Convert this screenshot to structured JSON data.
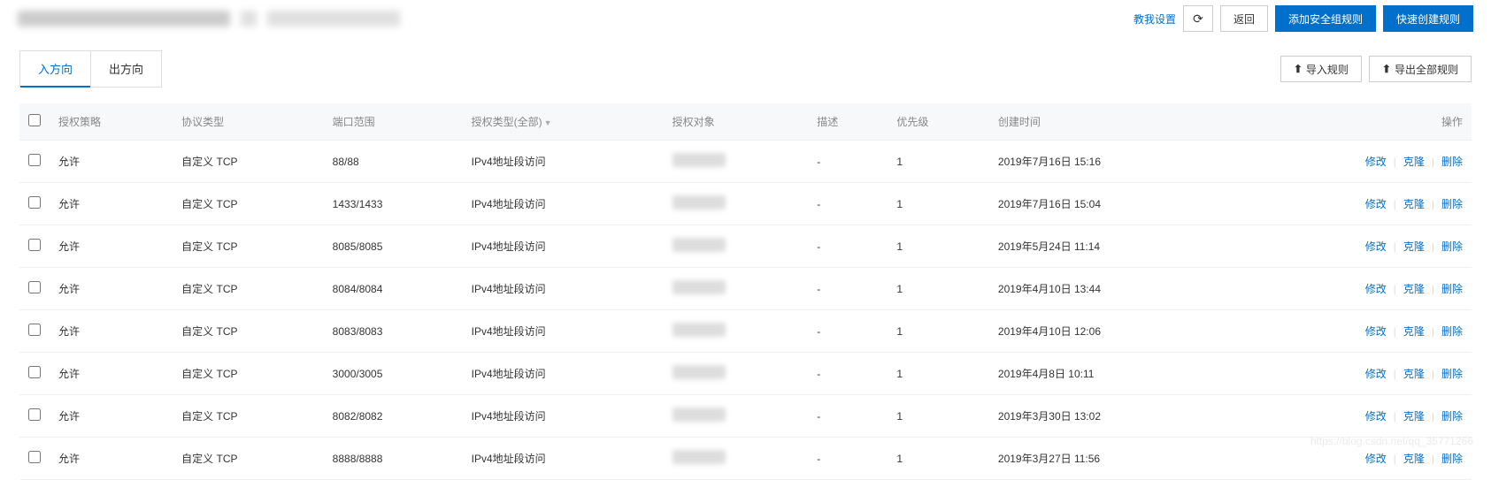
{
  "header": {
    "teach_me": "教我设置",
    "back": "返回",
    "add_rule": "添加安全组规则",
    "quick_rule": "快速创建规则"
  },
  "tabs": {
    "inbound": "入方向",
    "outbound": "出方向"
  },
  "sub_actions": {
    "import": "导入规则",
    "export": "导出全部规则"
  },
  "columns": {
    "policy": "授权策略",
    "protocol": "协议类型",
    "port": "端口范围",
    "auth_type": "授权类型(全部)",
    "target": "授权对象",
    "desc": "描述",
    "priority": "优先级",
    "created": "创建时间",
    "ops": "操作"
  },
  "row_ops": {
    "edit": "修改",
    "clone": "克隆",
    "delete": "删除"
  },
  "rows": [
    {
      "policy": "允许",
      "protocol": "自定义 TCP",
      "port": "88/88",
      "auth_type": "IPv4地址段访问",
      "desc": "-",
      "priority": "1",
      "created": "2019年7月16日 15:16"
    },
    {
      "policy": "允许",
      "protocol": "自定义 TCP",
      "port": "1433/1433",
      "auth_type": "IPv4地址段访问",
      "desc": "-",
      "priority": "1",
      "created": "2019年7月16日 15:04"
    },
    {
      "policy": "允许",
      "protocol": "自定义 TCP",
      "port": "8085/8085",
      "auth_type": "IPv4地址段访问",
      "desc": "-",
      "priority": "1",
      "created": "2019年5月24日 11:14"
    },
    {
      "policy": "允许",
      "protocol": "自定义 TCP",
      "port": "8084/8084",
      "auth_type": "IPv4地址段访问",
      "desc": "-",
      "priority": "1",
      "created": "2019年4月10日 13:44"
    },
    {
      "policy": "允许",
      "protocol": "自定义 TCP",
      "port": "8083/8083",
      "auth_type": "IPv4地址段访问",
      "desc": "-",
      "priority": "1",
      "created": "2019年4月10日 12:06"
    },
    {
      "policy": "允许",
      "protocol": "自定义 TCP",
      "port": "3000/3005",
      "auth_type": "IPv4地址段访问",
      "desc": "-",
      "priority": "1",
      "created": "2019年4月8日 10:11"
    },
    {
      "policy": "允许",
      "protocol": "自定义 TCP",
      "port": "8082/8082",
      "auth_type": "IPv4地址段访问",
      "desc": "-",
      "priority": "1",
      "created": "2019年3月30日 13:02"
    },
    {
      "policy": "允许",
      "protocol": "自定义 TCP",
      "port": "8888/8888",
      "auth_type": "IPv4地址段访问",
      "desc": "-",
      "priority": "1",
      "created": "2019年3月27日 11:56"
    }
  ],
  "watermark": "https://blog.csdn.net/qq_35771266"
}
